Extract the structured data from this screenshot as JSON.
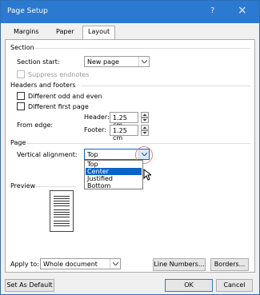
{
  "window": {
    "title": "Page Setup",
    "help": "?",
    "close": "×"
  },
  "tabs": [
    {
      "label": "Margins"
    },
    {
      "label": "Paper"
    },
    {
      "label": "Layout"
    }
  ],
  "section": {
    "heading": "Section",
    "start_label": "Section start:",
    "start_value": "New page",
    "suppress_label": "Suppress endnotes"
  },
  "headers_footers": {
    "heading": "Headers and footers",
    "diff_odd_even": "Different odd and even",
    "diff_first": "Different first page",
    "from_edge": "From edge:",
    "header_label": "Header:",
    "header_value": "1.25 cm",
    "footer_label": "Footer:",
    "footer_value": "1.25 cm"
  },
  "page": {
    "heading": "Page",
    "valign_label": "Vertical alignment:",
    "valign_value": "Top",
    "options": [
      "Top",
      "Center",
      "Justified",
      "Bottom"
    ],
    "selected_option": "Center"
  },
  "preview": {
    "heading": "Preview"
  },
  "apply": {
    "label": "Apply to:",
    "value": "Whole document"
  },
  "buttons": {
    "line_numbers": "Line Numbers...",
    "borders": "Borders...",
    "set_default": "Set As Default",
    "ok": "OK",
    "cancel": "Cancel"
  }
}
